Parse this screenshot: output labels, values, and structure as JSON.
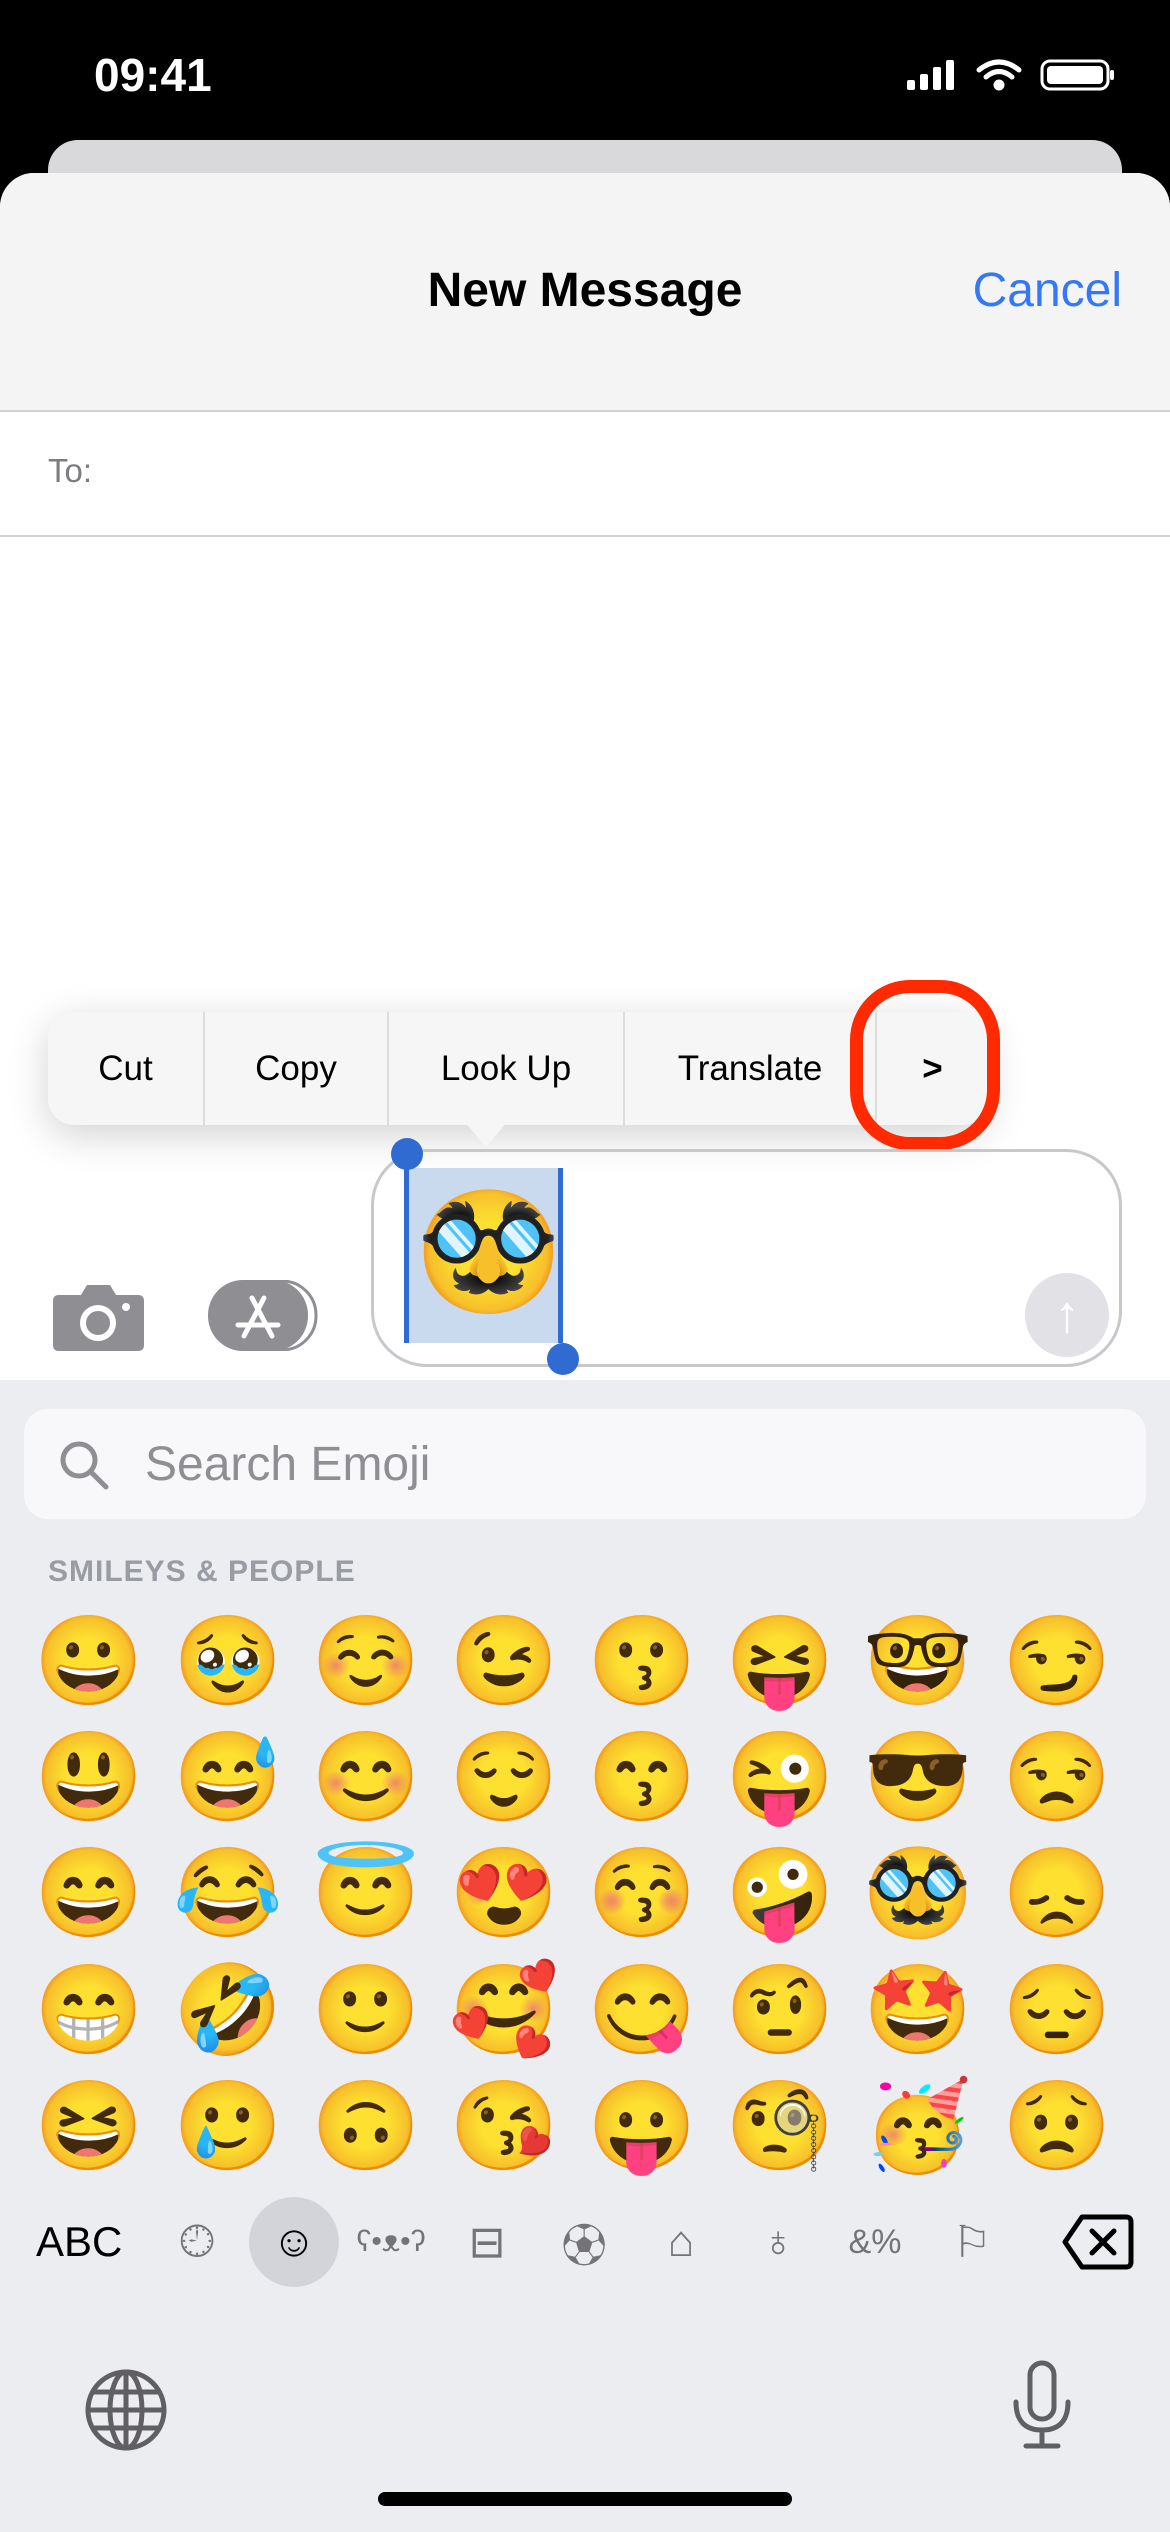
{
  "status_bar": {
    "time": "09:41",
    "icons": [
      "cellular-signal-icon",
      "wifi-icon",
      "battery-icon"
    ]
  },
  "header": {
    "title": "New Message",
    "cancel_label": "Cancel"
  },
  "recipient": {
    "label": "To:",
    "value": ""
  },
  "edit_menu": {
    "items": [
      "Cut",
      "Copy",
      "Look Up",
      "Translate"
    ],
    "more_label": ">"
  },
  "message_input": {
    "selected_text": "🥸"
  },
  "accent_color": "#3478F6",
  "highlight_color": "#FF2A00",
  "keyboard": {
    "search_placeholder": "Search Emoji",
    "category_title": "SMILEYS & PEOPLE",
    "emoji_rows": [
      [
        "😀",
        "🥹",
        "☺️",
        "😉",
        "😗",
        "😝",
        "🤓",
        "😏"
      ],
      [
        "😃",
        "😅",
        "😊",
        "😌",
        "😙",
        "😜",
        "😎",
        "😒"
      ],
      [
        "😄",
        "😂",
        "😇",
        "😍",
        "😚",
        "🤪",
        "🥸",
        "😞"
      ],
      [
        "😁",
        "🤣",
        "🙂",
        "🥰",
        "😋",
        "🤨",
        "🤩",
        "😔"
      ],
      [
        "😆",
        "🥲",
        "🙃",
        "😘",
        "😛",
        "🧐",
        "🥳",
        "😟"
      ]
    ],
    "abc_label": "ABC",
    "categories": [
      "recent-icon",
      "smileys-icon",
      "animals-icon",
      "food-icon",
      "activity-icon",
      "travel-icon",
      "objects-icon",
      "symbols-icon",
      "flags-icon"
    ],
    "selected_category": "smileys-icon"
  }
}
